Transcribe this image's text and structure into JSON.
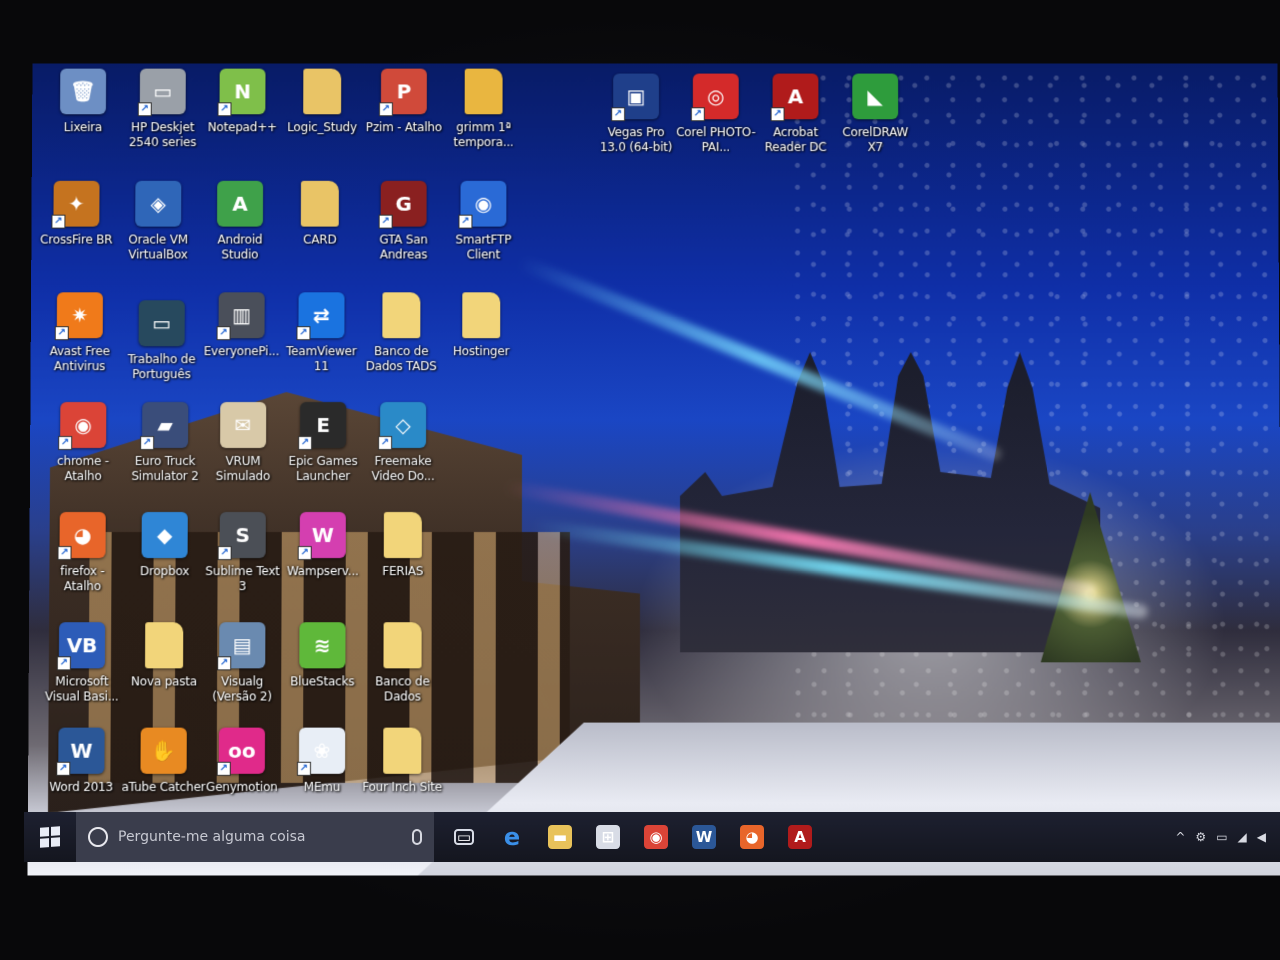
{
  "desktop": {
    "icons": [
      {
        "label": "Lixeira",
        "glyph": "🗑",
        "color": "#6d8fc4",
        "shortcut": false,
        "icon": "recycle-bin-icon"
      },
      {
        "label": "HP Deskjet 2540 series",
        "glyph": "▭",
        "color": "#9aa0a8",
        "shortcut": true,
        "icon": "printer-icon"
      },
      {
        "label": "Notepad++",
        "glyph": "N",
        "color": "#7fbf4a",
        "shortcut": true,
        "icon": "notepad-plus-plus-icon"
      },
      {
        "label": "Logic_Study",
        "glyph": "",
        "color": "#e9c466",
        "shortcut": false,
        "icon": "folder-icon"
      },
      {
        "label": "Pzim - Atalho",
        "glyph": "P",
        "color": "#d04a3a",
        "shortcut": true,
        "icon": "pzim-icon"
      },
      {
        "label": "grimm 1ª tempora...",
        "glyph": "",
        "color": "#e9b640",
        "shortcut": false,
        "icon": "folder-icon"
      },
      {
        "label": "Vegas Pro 13.0 (64-bit)",
        "glyph": "▣",
        "color": "#1f3f8a",
        "shortcut": true,
        "icon": "vegas-pro-icon"
      },
      {
        "label": "Corel PHOTO-PAI...",
        "glyph": "◎",
        "color": "#d42a2a",
        "shortcut": true,
        "icon": "corel-photo-paint-icon"
      },
      {
        "label": "Acrobat Reader DC",
        "glyph": "A",
        "color": "#b01b1b",
        "shortcut": true,
        "icon": "acrobat-reader-icon"
      },
      {
        "label": "CorelDRAW X7",
        "glyph": "◣",
        "color": "#2e9c3c",
        "shortcut": false,
        "icon": "coreldraw-icon"
      },
      {
        "label": "CrossFire BR",
        "glyph": "✦",
        "color": "#c5731f",
        "shortcut": true,
        "icon": "crossfire-icon"
      },
      {
        "label": "Oracle VM VirtualBox",
        "glyph": "◈",
        "color": "#2f66b8",
        "shortcut": false,
        "icon": "virtualbox-icon"
      },
      {
        "label": "Android Studio",
        "glyph": "A",
        "color": "#3fa14a",
        "shortcut": false,
        "icon": "android-studio-icon"
      },
      {
        "label": "CARD",
        "glyph": "",
        "color": "#e9c466",
        "shortcut": false,
        "icon": "folder-icon"
      },
      {
        "label": "GTA San Andreas",
        "glyph": "G",
        "color": "#8a2020",
        "shortcut": true,
        "icon": "gta-san-andreas-icon"
      },
      {
        "label": "SmartFTP Client",
        "glyph": "◉",
        "color": "#2a6ad6",
        "shortcut": true,
        "icon": "smartftp-icon"
      },
      {
        "label": "Avast Free Antivirus",
        "glyph": "✷",
        "color": "#f07a1a",
        "shortcut": true,
        "icon": "avast-icon"
      },
      {
        "label": "Trabalho de Português",
        "glyph": "▭",
        "color": "#27495e",
        "shortcut": false,
        "icon": "document-icon"
      },
      {
        "label": "EveryonePi...",
        "glyph": "▥",
        "color": "#4a4f5a",
        "shortcut": true,
        "icon": "everyonepiano-icon"
      },
      {
        "label": "TeamViewer 11",
        "glyph": "⇄",
        "color": "#1a73e0",
        "shortcut": true,
        "icon": "teamviewer-icon"
      },
      {
        "label": "Banco de Dados TADS",
        "glyph": "",
        "color": "#f2d57a",
        "shortcut": false,
        "icon": "folder-icon"
      },
      {
        "label": "Hostinger",
        "glyph": "",
        "color": "#f2d57a",
        "shortcut": false,
        "icon": "folder-icon"
      },
      {
        "label": "chrome - Atalho",
        "glyph": "◉",
        "color": "#db4437",
        "shortcut": true,
        "icon": "chrome-icon"
      },
      {
        "label": "Euro Truck Simulator 2",
        "glyph": "▰",
        "color": "#3a4d7a",
        "shortcut": true,
        "icon": "euro-truck-icon"
      },
      {
        "label": "VRUM Simulado",
        "glyph": "✉",
        "color": "#d8c9a8",
        "shortcut": false,
        "icon": "vrum-icon"
      },
      {
        "label": "Epic Games Launcher",
        "glyph": "E",
        "color": "#2a2a2a",
        "shortcut": true,
        "icon": "epic-games-icon"
      },
      {
        "label": "Freemake Video Do...",
        "glyph": "◇",
        "color": "#2a8ac8",
        "shortcut": true,
        "icon": "freemake-icon"
      },
      {
        "label": "firefox - Atalho",
        "glyph": "◕",
        "color": "#e8652a",
        "shortcut": true,
        "icon": "firefox-icon"
      },
      {
        "label": "Dropbox",
        "glyph": "◆",
        "color": "#2f86d6",
        "shortcut": false,
        "icon": "dropbox-icon"
      },
      {
        "label": "Sublime Text 3",
        "glyph": "S",
        "color": "#4b4f56",
        "shortcut": true,
        "icon": "sublime-text-icon"
      },
      {
        "label": "Wampserv...",
        "glyph": "W",
        "color": "#d43fb0",
        "shortcut": true,
        "icon": "wampserver-icon"
      },
      {
        "label": "FERIAS",
        "glyph": "",
        "color": "#f2d57a",
        "shortcut": false,
        "icon": "folder-icon"
      },
      {
        "label": "Microsoft Visual Basi...",
        "glyph": "VB",
        "color": "#2d5cb8",
        "shortcut": true,
        "icon": "visual-basic-icon"
      },
      {
        "label": "Nova pasta",
        "glyph": "",
        "color": "#f2d57a",
        "shortcut": false,
        "icon": "folder-icon"
      },
      {
        "label": "Visualg (Versão 2)",
        "glyph": "▤",
        "color": "#6a8ab0",
        "shortcut": true,
        "icon": "visualg-icon"
      },
      {
        "label": "BlueStacks",
        "glyph": "≋",
        "color": "#5fb83a",
        "shortcut": false,
        "icon": "bluestacks-icon"
      },
      {
        "label": "Banco de Dados",
        "glyph": "",
        "color": "#f2d57a",
        "shortcut": false,
        "icon": "folder-icon"
      },
      {
        "label": "Word 2013",
        "glyph": "W",
        "color": "#2b5797",
        "shortcut": true,
        "icon": "word-icon"
      },
      {
        "label": "aTube Catcher",
        "glyph": "✋",
        "color": "#e88a22",
        "shortcut": false,
        "icon": "atube-catcher-icon"
      },
      {
        "label": "Genymotion",
        "glyph": "oo",
        "color": "#e02a8a",
        "shortcut": true,
        "icon": "genymotion-icon"
      },
      {
        "label": "MEmu",
        "glyph": "❀",
        "color": "#e8eef6",
        "shortcut": true,
        "icon": "memu-icon"
      },
      {
        "label": "Four Inch Site",
        "glyph": "",
        "color": "#f2d57a",
        "shortcut": false,
        "icon": "folder-icon"
      }
    ]
  },
  "taskbar": {
    "search_placeholder": "Pergunte-me alguma coisa",
    "pinned": [
      {
        "name": "task-view",
        "glyph": "▭",
        "color": "transparent"
      },
      {
        "name": "edge",
        "glyph": "e",
        "color": "transparent",
        "text_color": "#3a8fe8"
      },
      {
        "name": "file-explorer",
        "glyph": "▬",
        "color": "#e8c25a"
      },
      {
        "name": "store",
        "glyph": "⊞",
        "color": "#d8dce6"
      },
      {
        "name": "chrome",
        "glyph": "◉",
        "color": "#db4437"
      },
      {
        "name": "word",
        "glyph": "W",
        "color": "#2b5797"
      },
      {
        "name": "firefox",
        "glyph": "◕",
        "color": "#e8652a"
      },
      {
        "name": "acrobat",
        "glyph": "A",
        "color": "#b01b1b"
      }
    ],
    "tray_icons": [
      "^",
      "⚙",
      "▭",
      "◢",
      "◀"
    ]
  }
}
